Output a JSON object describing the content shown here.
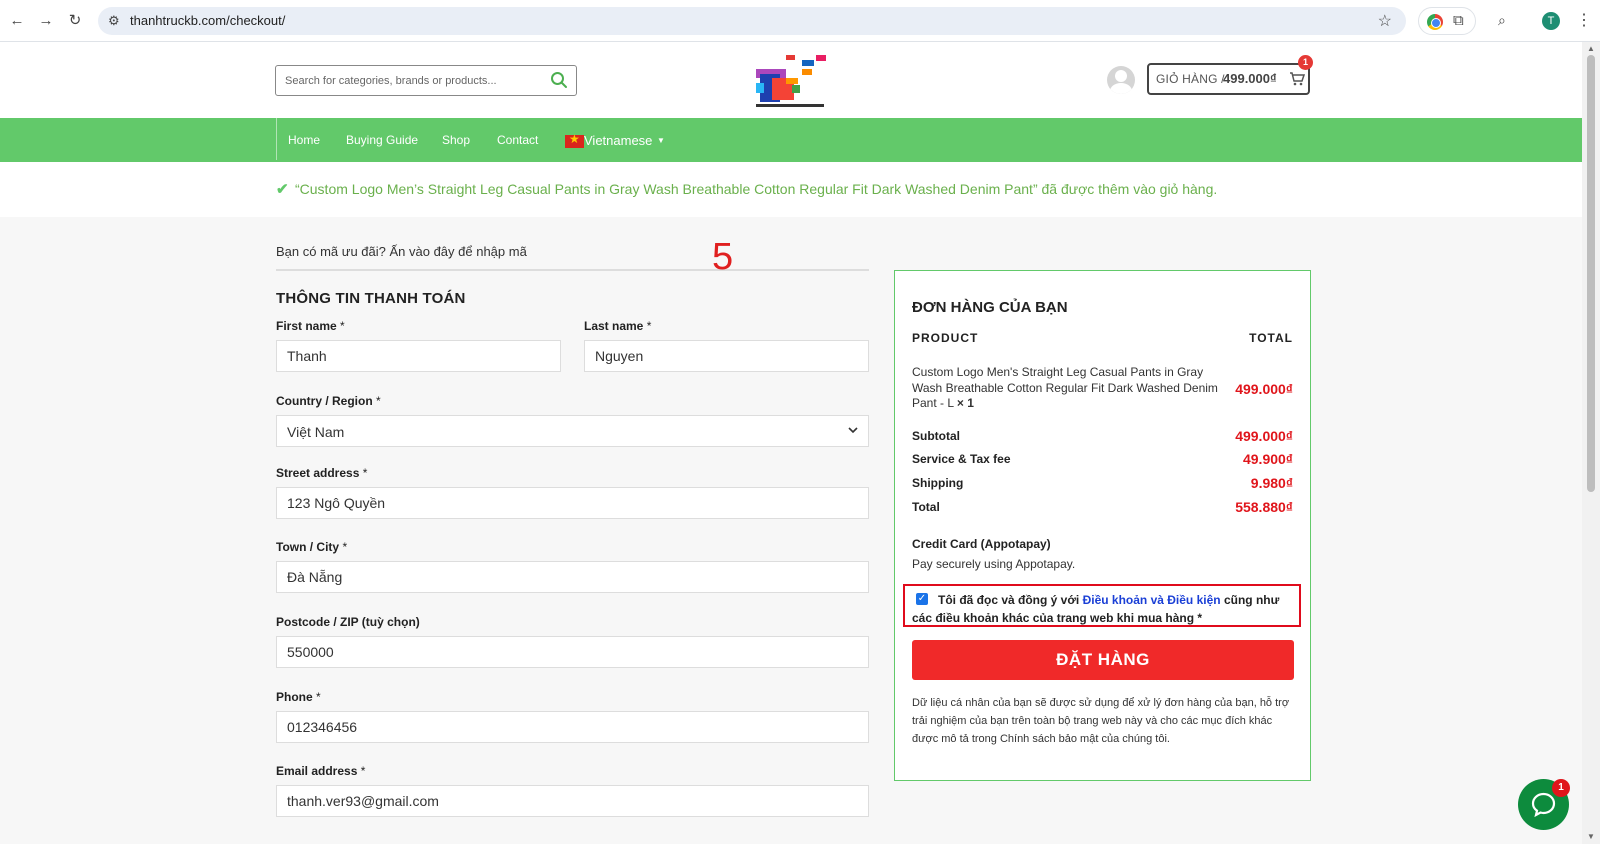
{
  "browser": {
    "url": "thanhtruckb.com/checkout/",
    "profile_initial": "T"
  },
  "header": {
    "search_placeholder": "Search for categories, brands or products...",
    "cart_label": "GIỎ HÀNG /",
    "cart_amount": "499.000₫",
    "cart_count": "1"
  },
  "nav": {
    "items": [
      "Home",
      "Buying Guide",
      "Shop",
      "Contact"
    ],
    "language": "Vietnamese"
  },
  "notice": {
    "text": "“Custom Logo Men’s Straight Leg Casual Pants in Gray Wash Breathable Cotton Regular Fit Dark Washed Denim Pant” đã được thêm vào giỏ hàng."
  },
  "coupon": {
    "text": "Bạn có mã ưu đãi? Ấn vào đây để nhập mã"
  },
  "annotation": "5",
  "billing": {
    "title": "THÔNG TIN THANH TOÁN",
    "first_name_label": "First name",
    "first_name_value": "Thanh",
    "last_name_label": "Last name",
    "last_name_value": "Nguyen",
    "country_label": "Country / Region",
    "country_value": "Việt Nam",
    "street_label": "Street address",
    "street_value": "123 Ngô Quyền",
    "city_label": "Town / City",
    "city_value": "Đà Nẵng",
    "postcode_label": "Postcode / ZIP (tuỳ chọn)",
    "postcode_value": "550000",
    "phone_label": "Phone",
    "phone_value": "012346456",
    "email_label": "Email address",
    "email_value": "thanh.ver93@gmail.com",
    "required_mark": "*"
  },
  "order": {
    "title": "ĐƠN HÀNG CỦA BẠN",
    "col_product": "PRODUCT",
    "col_total": "TOTAL",
    "product_name": "Custom Logo Men's Straight Leg Casual Pants in Gray Wash Breathable Cotton Regular Fit Dark Washed Denim Pant - L",
    "product_qty": "× 1",
    "product_price": "499.000₫",
    "subtotal_label": "Subtotal",
    "subtotal_value": "499.000₫",
    "service_label": "Service & Tax fee",
    "service_value": "49.900₫",
    "shipping_label": "Shipping",
    "shipping_value": "9.980₫",
    "total_label": "Total",
    "total_value": "558.880₫",
    "payment_title": "Credit Card (Appotapay)",
    "payment_desc": "Pay securely using Appotapay.",
    "terms_before": "Tôi đã đọc và đồng ý với ",
    "terms_link": "Điều khoản và Điều kiện",
    "terms_after": " cũng như các điều khoản khác của trang web khi mua hàng *",
    "button_label": "ĐẶT HÀNG",
    "privacy": "Dữ liệu cá nhân của bạn sẽ được sử dụng để xử lý đơn hàng của bạn, hỗ trợ trải nghiệm của bạn trên toàn bộ trang web này và cho các mục đích khác được mô tả trong Chính sách bảo mật của chúng tôi."
  },
  "chat": {
    "badge": "1"
  },
  "colors": {
    "nav_green": "#62c96a",
    "price_red": "#e0151b",
    "button_red": "#f02929",
    "link_blue": "#1a3fd6"
  }
}
